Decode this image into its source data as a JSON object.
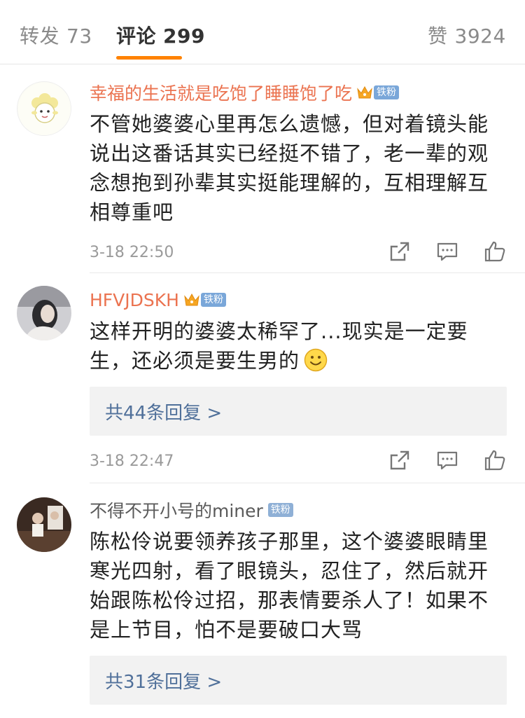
{
  "tabs": {
    "repost": {
      "label": "转发",
      "count": "73"
    },
    "comment": {
      "label": "评论",
      "count": "299"
    },
    "like": {
      "label": "赞",
      "count": "3924"
    }
  },
  "colors": {
    "accent": "#ff8200",
    "vip_name": "#eb7350",
    "link": "#50709a",
    "badge": "#7aa7d9"
  },
  "comments": [
    {
      "name": "幸福的生活就是吃饱了睡睡饱了吃",
      "badge": "铁粉",
      "avatar_icon": "sheep-avatar",
      "text": "不管她婆婆心里再怎么遗憾，但对着镜头能说出这番话其实已经挺不错了，老一辈的观念想抱到孙辈其实挺能理解的，互相理解互相尊重吧",
      "time": "3-18 22:50"
    },
    {
      "name": "HFVJDSKH",
      "badge": "铁粉",
      "avatar_icon": "photo-avatar",
      "text": "这样开明的婆婆太稀罕了...现实是一定要生，还必须是要生男的",
      "emoji": "smile-emoji",
      "reply": "共44条回复 >",
      "time": "3-18 22:47"
    },
    {
      "name": "不得不开小号的miner",
      "badge": "铁粉",
      "avatar_icon": "photo-avatar",
      "text": "陈松伶说要领养孩子那里，这个婆婆眼睛里寒光四射，看了眼镜头，忍住了，然后就开始跟陈松伶过招，那表情要杀人了！如果不是上节目，怕不是要破口大骂",
      "reply": "共31条回复 >"
    }
  ],
  "icons": {
    "share": "share-icon",
    "reply": "comment-icon",
    "like": "thumbs-up-icon",
    "crown": "crown-icon"
  }
}
